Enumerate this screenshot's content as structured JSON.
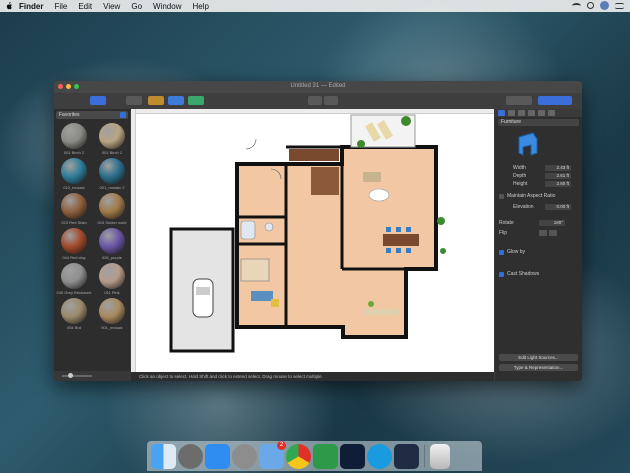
{
  "menubar": {
    "app": "Finder",
    "items": [
      "File",
      "Edit",
      "View",
      "Go",
      "Window",
      "Help"
    ]
  },
  "window": {
    "title": "Untitled 31 — Edited"
  },
  "left_panel": {
    "favorites_label": "Favorites",
    "swatches": [
      {
        "label": "001 Birch 2",
        "color": "#8a8a84"
      },
      {
        "label": "001 Birch 2",
        "color": "#b8a482"
      },
      {
        "label": "010_mosaic",
        "color": "#2e7d9a"
      },
      {
        "label": "001_mosaic 2",
        "color": "#2b6f8e"
      },
      {
        "label": "023 Red Stain",
        "color": "#8f5f3c"
      },
      {
        "label": "015 Sulder work",
        "color": "#a07a48"
      },
      {
        "label": "044 Red clay",
        "color": "#a14a2a"
      },
      {
        "label": "026_purple",
        "color": "#6a56a8"
      },
      {
        "label": "045 Grey Brickwork",
        "color": "#8e8e8e"
      },
      {
        "label": "011 Pink",
        "color": "#b79b8a"
      },
      {
        "label": "054 Brd",
        "color": "#9a8a6a"
      },
      {
        "label": "001_mosaic",
        "color": "#a88a5e"
      }
    ],
    "zoom_value": "20"
  },
  "statusbar": {
    "text": "Click an object to select. Hold Shift and click to extend select. Drag mouse to select multiple."
  },
  "right_panel": {
    "dropdown": "Furniture",
    "fields": [
      {
        "label": "Width",
        "value": "2.43 ft"
      },
      {
        "label": "Depth",
        "value": "2.61 ft"
      },
      {
        "label": "Height",
        "value": "2.60 ft"
      }
    ],
    "maintain_aspect": "Maintain Aspect Ratio",
    "elevation": {
      "label": "Elevation",
      "value": "0.00 ft"
    },
    "rotate_label": "Rotate",
    "rotate_value": "180°",
    "flip_label": "Flip",
    "glow_by": "Glow by",
    "cast_shadows": "Cast Shadows",
    "edit_light_button": "Edit Light Sources...",
    "type_button": "Type & Representation..."
  },
  "dock": {
    "mail_badge": "2"
  },
  "colors": {
    "accent": "#2f6fd6",
    "floor": "#f2c8a4",
    "wall": "#111111"
  }
}
